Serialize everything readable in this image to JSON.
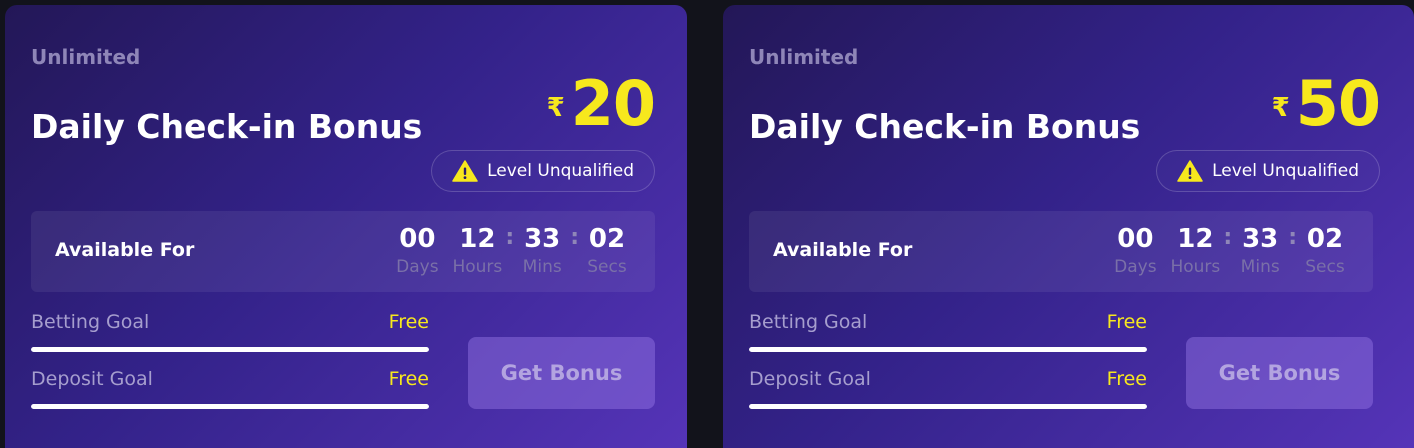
{
  "colors": {
    "page_background": "#12131b",
    "accent_yellow": "#f7e81d",
    "card_gradient_start": "#231757",
    "card_gradient_end": "#5534b8"
  },
  "cards": [
    {
      "tag": "Unlimited",
      "title": "Daily Check-in Bonus",
      "currency_symbol": "₹",
      "amount": "20",
      "qualification": {
        "icon": "warning-icon",
        "text": "Level Unqualified"
      },
      "available": {
        "label": "Available For",
        "days": "00",
        "days_label": "Days",
        "hours": "12",
        "hours_label": "Hours",
        "mins": "33",
        "mins_label": "Mins",
        "secs": "02",
        "secs_label": "Secs"
      },
      "goals": [
        {
          "label": "Betting Goal",
          "value": "Free",
          "progress": 1.0
        },
        {
          "label": "Deposit Goal",
          "value": "Free",
          "progress": 1.0
        }
      ],
      "button_label": "Get Bonus"
    },
    {
      "tag": "Unlimited",
      "title": "Daily Check-in Bonus",
      "currency_symbol": "₹",
      "amount": "50",
      "qualification": {
        "icon": "warning-icon",
        "text": "Level Unqualified"
      },
      "available": {
        "label": "Available For",
        "days": "00",
        "days_label": "Days",
        "hours": "12",
        "hours_label": "Hours",
        "mins": "33",
        "mins_label": "Mins",
        "secs": "02",
        "secs_label": "Secs"
      },
      "goals": [
        {
          "label": "Betting Goal",
          "value": "Free",
          "progress": 1.0
        },
        {
          "label": "Deposit Goal",
          "value": "Free",
          "progress": 1.0
        }
      ],
      "button_label": "Get Bonus"
    }
  ]
}
